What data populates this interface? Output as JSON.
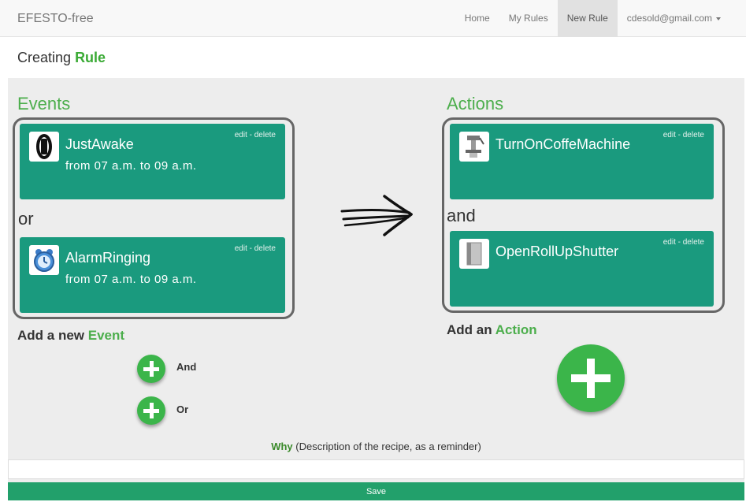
{
  "navbar": {
    "brand": "EFESTO-free",
    "items": [
      {
        "label": "Home",
        "active": false
      },
      {
        "label": "My Rules",
        "active": false
      },
      {
        "label": "New Rule",
        "active": true
      }
    ],
    "user": "cdesold@gmail.com"
  },
  "heading": {
    "prefix": "Creating",
    "highlight": "Rule"
  },
  "events": {
    "title": "Events",
    "cards": [
      {
        "name": "JustAwake",
        "time": "from 07 a.m. to 09 a.m.",
        "links": "edit - delete",
        "icon": "fitness-band-icon"
      },
      {
        "name": "AlarmRinging",
        "time": "from 07 a.m. to 09 a.m.",
        "links": "edit - delete",
        "icon": "alarm-clock-icon"
      }
    ],
    "connector": "or",
    "add_prefix": "Add a new",
    "add_highlight": "Event",
    "add_buttons": [
      {
        "label": "And"
      },
      {
        "label": "Or"
      }
    ]
  },
  "actions": {
    "title": "Actions",
    "cards": [
      {
        "name": "TurnOnCoffeMachine",
        "links": "edit - delete",
        "icon": "coffee-machine-icon"
      },
      {
        "name": "OpenRollUpShutter",
        "links": "edit - delete",
        "icon": "roller-shutter-icon"
      }
    ],
    "connector": "and",
    "add_prefix": "Add an",
    "add_highlight": "Action"
  },
  "why": {
    "label": "Why",
    "description": "(Description of the recipe, as a reminder)",
    "value": ""
  },
  "save_label": "Save",
  "colors": {
    "accent_green": "#4cae4c",
    "card_teal": "#1a9a7e",
    "save_green": "#22a06b",
    "plus_green": "#3bb54a"
  }
}
